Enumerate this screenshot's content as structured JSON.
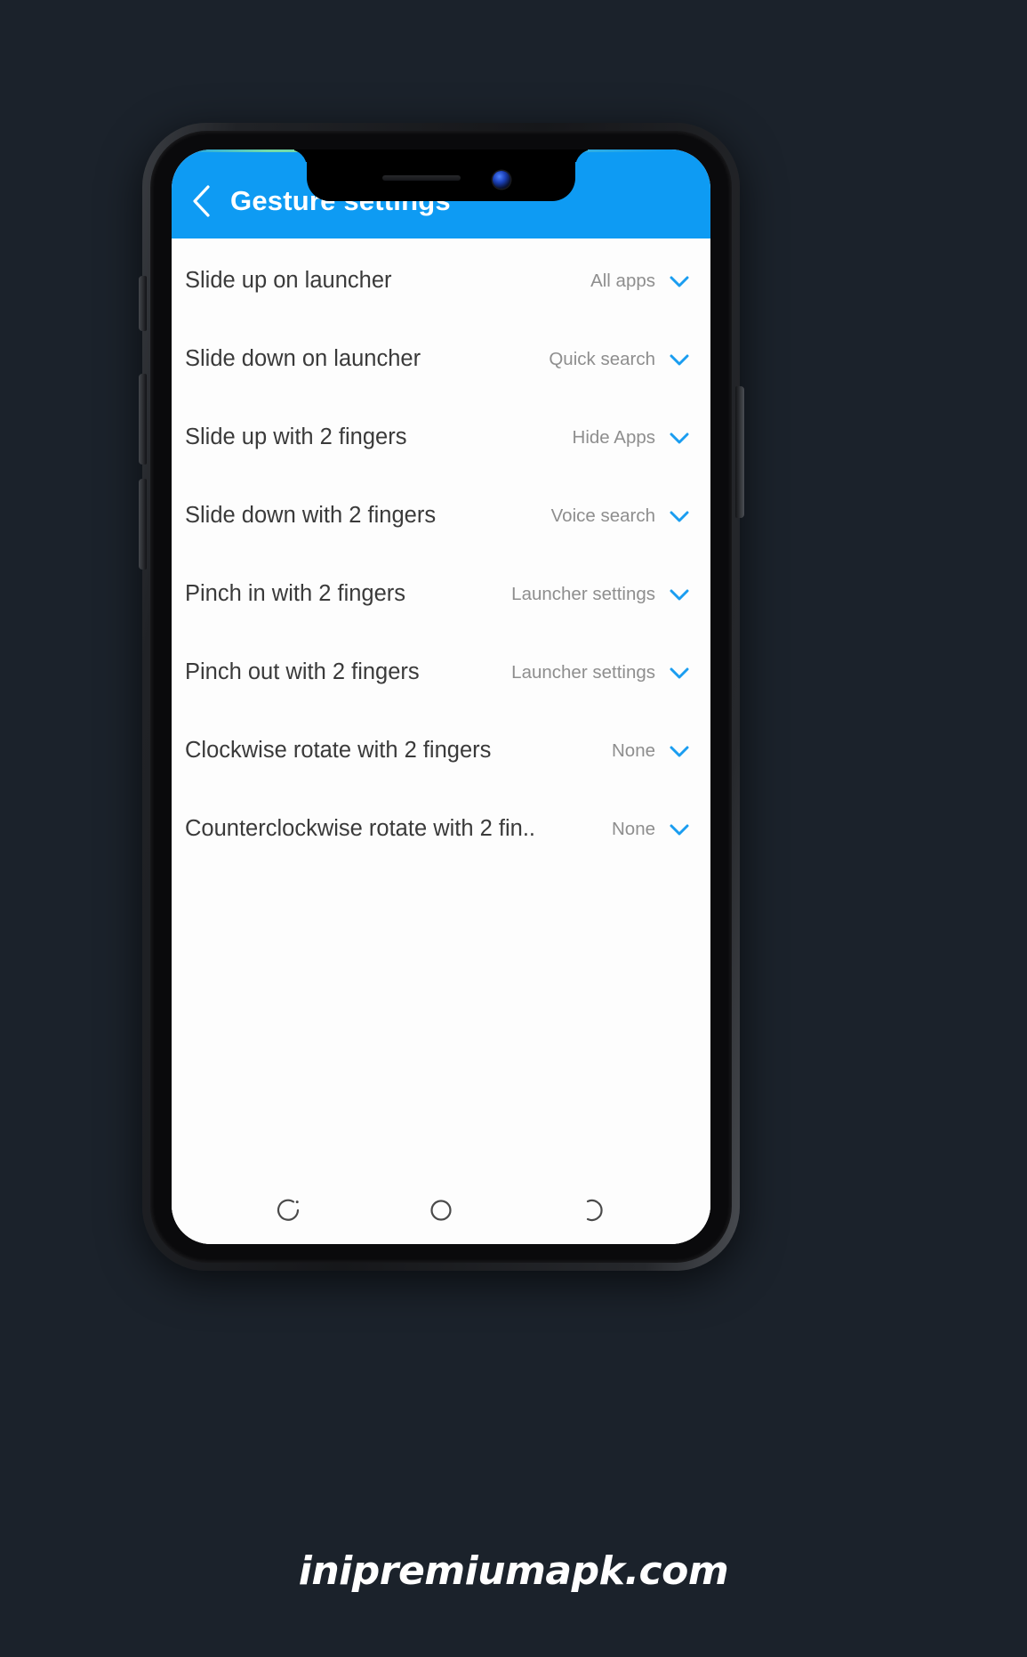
{
  "appbar": {
    "title": "Gesture settings",
    "back_icon": "chevron-left-icon",
    "background_color": "#0e9bf3",
    "title_color": "#ffffff"
  },
  "list": {
    "rows": [
      {
        "label": "Slide up on launcher",
        "value": "All apps",
        "chevron_icon": "chevron-down-icon"
      },
      {
        "label": "Slide down on launcher",
        "value": "Quick search",
        "chevron_icon": "chevron-down-icon"
      },
      {
        "label": "Slide up with 2 fingers",
        "value": "Hide Apps",
        "chevron_icon": "chevron-down-icon"
      },
      {
        "label": "Slide down with 2 fingers",
        "value": "Voice search",
        "chevron_icon": "chevron-down-icon"
      },
      {
        "label": "Pinch in with 2 fingers",
        "value": "Launcher settings",
        "chevron_icon": "chevron-down-icon"
      },
      {
        "label": "Pinch out with 2 fingers",
        "value": "Launcher settings",
        "chevron_icon": "chevron-down-icon"
      },
      {
        "label": "Clockwise rotate with 2 fingers",
        "value": "None",
        "chevron_icon": "chevron-down-icon"
      },
      {
        "label": "Counterclockwise rotate with 2 fin..",
        "value": "None",
        "chevron_icon": "chevron-down-icon"
      }
    ],
    "label_color": "#3a3a3a",
    "value_color": "#8e8e8e",
    "chevron_color": "#1a9df0",
    "background_color": "#fdfdfd"
  },
  "navbar": {
    "buttons": [
      {
        "name": "recents-button",
        "icon": "recents-icon"
      },
      {
        "name": "home-button",
        "icon": "home-circle-icon"
      },
      {
        "name": "back-button",
        "icon": "back-arc-icon"
      }
    ],
    "icon_color": "#4a4a4a"
  },
  "watermark": {
    "text": "inipremiumapk.com"
  },
  "page": {
    "background_color": "#1b222b"
  }
}
